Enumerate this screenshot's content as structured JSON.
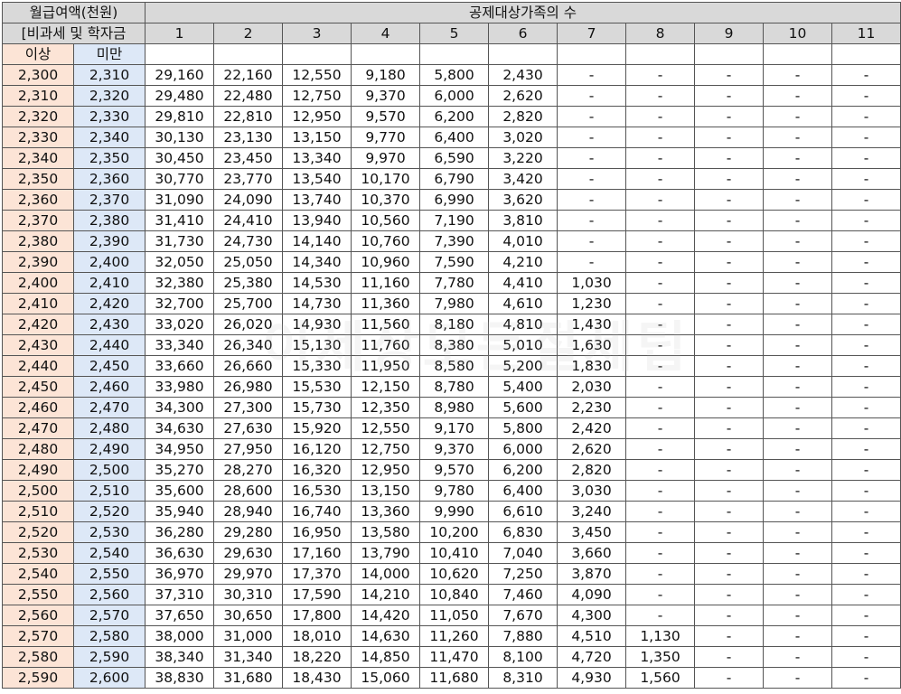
{
  "header": {
    "col_title_line1": "월급여액(천원)",
    "col_title_line2": "[비과세 및 학자금",
    "lower_label": "이상",
    "upper_label": "미만",
    "family_title": "공제대상가족의 수",
    "family_counts": [
      "1",
      "2",
      "3",
      "4",
      "5",
      "6",
      "7",
      "8",
      "9",
      "10",
      "11"
    ]
  },
  "rows": [
    {
      "lo": "2,300",
      "hi": "2,310",
      "v": [
        "29,160",
        "22,160",
        "12,550",
        "9,180",
        "5,800",
        "2,430",
        "-",
        "-",
        "-",
        "-",
        "-"
      ]
    },
    {
      "lo": "2,310",
      "hi": "2,320",
      "v": [
        "29,480",
        "22,480",
        "12,750",
        "9,370",
        "6,000",
        "2,620",
        "-",
        "-",
        "-",
        "-",
        "-"
      ]
    },
    {
      "lo": "2,320",
      "hi": "2,330",
      "v": [
        "29,810",
        "22,810",
        "12,950",
        "9,570",
        "6,200",
        "2,820",
        "-",
        "-",
        "-",
        "-",
        "-"
      ]
    },
    {
      "lo": "2,330",
      "hi": "2,340",
      "v": [
        "30,130",
        "23,130",
        "13,150",
        "9,770",
        "6,400",
        "3,020",
        "-",
        "-",
        "-",
        "-",
        "-"
      ]
    },
    {
      "lo": "2,340",
      "hi": "2,350",
      "v": [
        "30,450",
        "23,450",
        "13,340",
        "9,970",
        "6,590",
        "3,220",
        "-",
        "-",
        "-",
        "-",
        "-"
      ]
    },
    {
      "lo": "2,350",
      "hi": "2,360",
      "v": [
        "30,770",
        "23,770",
        "13,540",
        "10,170",
        "6,790",
        "3,420",
        "-",
        "-",
        "-",
        "-",
        "-"
      ]
    },
    {
      "lo": "2,360",
      "hi": "2,370",
      "v": [
        "31,090",
        "24,090",
        "13,740",
        "10,370",
        "6,990",
        "3,620",
        "-",
        "-",
        "-",
        "-",
        "-"
      ]
    },
    {
      "lo": "2,370",
      "hi": "2,380",
      "v": [
        "31,410",
        "24,410",
        "13,940",
        "10,560",
        "7,190",
        "3,810",
        "-",
        "-",
        "-",
        "-",
        "-"
      ]
    },
    {
      "lo": "2,380",
      "hi": "2,390",
      "v": [
        "31,730",
        "24,730",
        "14,140",
        "10,760",
        "7,390",
        "4,010",
        "-",
        "-",
        "-",
        "-",
        "-"
      ]
    },
    {
      "lo": "2,390",
      "hi": "2,400",
      "v": [
        "32,050",
        "25,050",
        "14,340",
        "10,960",
        "7,590",
        "4,210",
        "-",
        "-",
        "-",
        "-",
        "-"
      ]
    },
    {
      "lo": "2,400",
      "hi": "2,410",
      "v": [
        "32,380",
        "25,380",
        "14,530",
        "11,160",
        "7,780",
        "4,410",
        "1,030",
        "-",
        "-",
        "-",
        "-"
      ]
    },
    {
      "lo": "2,410",
      "hi": "2,420",
      "v": [
        "32,700",
        "25,700",
        "14,730",
        "11,360",
        "7,980",
        "4,610",
        "1,230",
        "-",
        "-",
        "-",
        "-"
      ]
    },
    {
      "lo": "2,420",
      "hi": "2,430",
      "v": [
        "33,020",
        "26,020",
        "14,930",
        "11,560",
        "8,180",
        "4,810",
        "1,430",
        "-",
        "-",
        "-",
        "-"
      ]
    },
    {
      "lo": "2,430",
      "hi": "2,440",
      "v": [
        "33,340",
        "26,340",
        "15,130",
        "11,760",
        "8,380",
        "5,010",
        "1,630",
        "-",
        "-",
        "-",
        "-"
      ]
    },
    {
      "lo": "2,440",
      "hi": "2,450",
      "v": [
        "33,660",
        "26,660",
        "15,330",
        "11,950",
        "8,580",
        "5,200",
        "1,830",
        "-",
        "-",
        "-",
        "-"
      ]
    },
    {
      "lo": "2,450",
      "hi": "2,460",
      "v": [
        "33,980",
        "26,980",
        "15,530",
        "12,150",
        "8,780",
        "5,400",
        "2,030",
        "-",
        "-",
        "-",
        "-"
      ]
    },
    {
      "lo": "2,460",
      "hi": "2,470",
      "v": [
        "34,300",
        "27,300",
        "15,730",
        "12,350",
        "8,980",
        "5,600",
        "2,230",
        "-",
        "-",
        "-",
        "-"
      ]
    },
    {
      "lo": "2,470",
      "hi": "2,480",
      "v": [
        "34,630",
        "27,630",
        "15,920",
        "12,550",
        "9,170",
        "5,800",
        "2,420",
        "-",
        "-",
        "-",
        "-"
      ]
    },
    {
      "lo": "2,480",
      "hi": "2,490",
      "v": [
        "34,950",
        "27,950",
        "16,120",
        "12,750",
        "9,370",
        "6,000",
        "2,620",
        "-",
        "-",
        "-",
        "-"
      ]
    },
    {
      "lo": "2,490",
      "hi": "2,500",
      "v": [
        "35,270",
        "28,270",
        "16,320",
        "12,950",
        "9,570",
        "6,200",
        "2,820",
        "-",
        "-",
        "-",
        "-"
      ]
    },
    {
      "lo": "2,500",
      "hi": "2,510",
      "v": [
        "35,600",
        "28,600",
        "16,530",
        "13,150",
        "9,780",
        "6,400",
        "3,030",
        "-",
        "-",
        "-",
        "-"
      ]
    },
    {
      "lo": "2,510",
      "hi": "2,520",
      "v": [
        "35,940",
        "28,940",
        "16,740",
        "13,360",
        "9,990",
        "6,610",
        "3,240",
        "-",
        "-",
        "-",
        "-"
      ]
    },
    {
      "lo": "2,520",
      "hi": "2,530",
      "v": [
        "36,280",
        "29,280",
        "16,950",
        "13,580",
        "10,200",
        "6,830",
        "3,450",
        "-",
        "-",
        "-",
        "-"
      ]
    },
    {
      "lo": "2,530",
      "hi": "2,540",
      "v": [
        "36,630",
        "29,630",
        "17,160",
        "13,790",
        "10,410",
        "7,040",
        "3,660",
        "-",
        "-",
        "-",
        "-"
      ]
    },
    {
      "lo": "2,540",
      "hi": "2,550",
      "v": [
        "36,970",
        "29,970",
        "17,370",
        "14,000",
        "10,620",
        "7,250",
        "3,870",
        "-",
        "-",
        "-",
        "-"
      ]
    },
    {
      "lo": "2,550",
      "hi": "2,560",
      "v": [
        "37,310",
        "30,310",
        "17,590",
        "14,210",
        "10,840",
        "7,460",
        "4,090",
        "-",
        "-",
        "-",
        "-"
      ]
    },
    {
      "lo": "2,560",
      "hi": "2,570",
      "v": [
        "37,650",
        "30,650",
        "17,800",
        "14,420",
        "11,050",
        "7,670",
        "4,300",
        "-",
        "-",
        "-",
        "-"
      ]
    },
    {
      "lo": "2,570",
      "hi": "2,580",
      "v": [
        "38,000",
        "31,000",
        "18,010",
        "14,630",
        "11,260",
        "7,880",
        "4,510",
        "1,130",
        "-",
        "-",
        "-"
      ]
    },
    {
      "lo": "2,580",
      "hi": "2,590",
      "v": [
        "38,340",
        "31,340",
        "18,220",
        "14,850",
        "11,470",
        "8,100",
        "4,720",
        "1,350",
        "-",
        "-",
        "-"
      ]
    },
    {
      "lo": "2,590",
      "hi": "2,600",
      "v": [
        "38,830",
        "31,680",
        "18,430",
        "15,060",
        "11,680",
        "8,310",
        "4,930",
        "1,560",
        "-",
        "-",
        "-"
      ]
    }
  ],
  "watermark_text": "이세상모든절세팁"
}
